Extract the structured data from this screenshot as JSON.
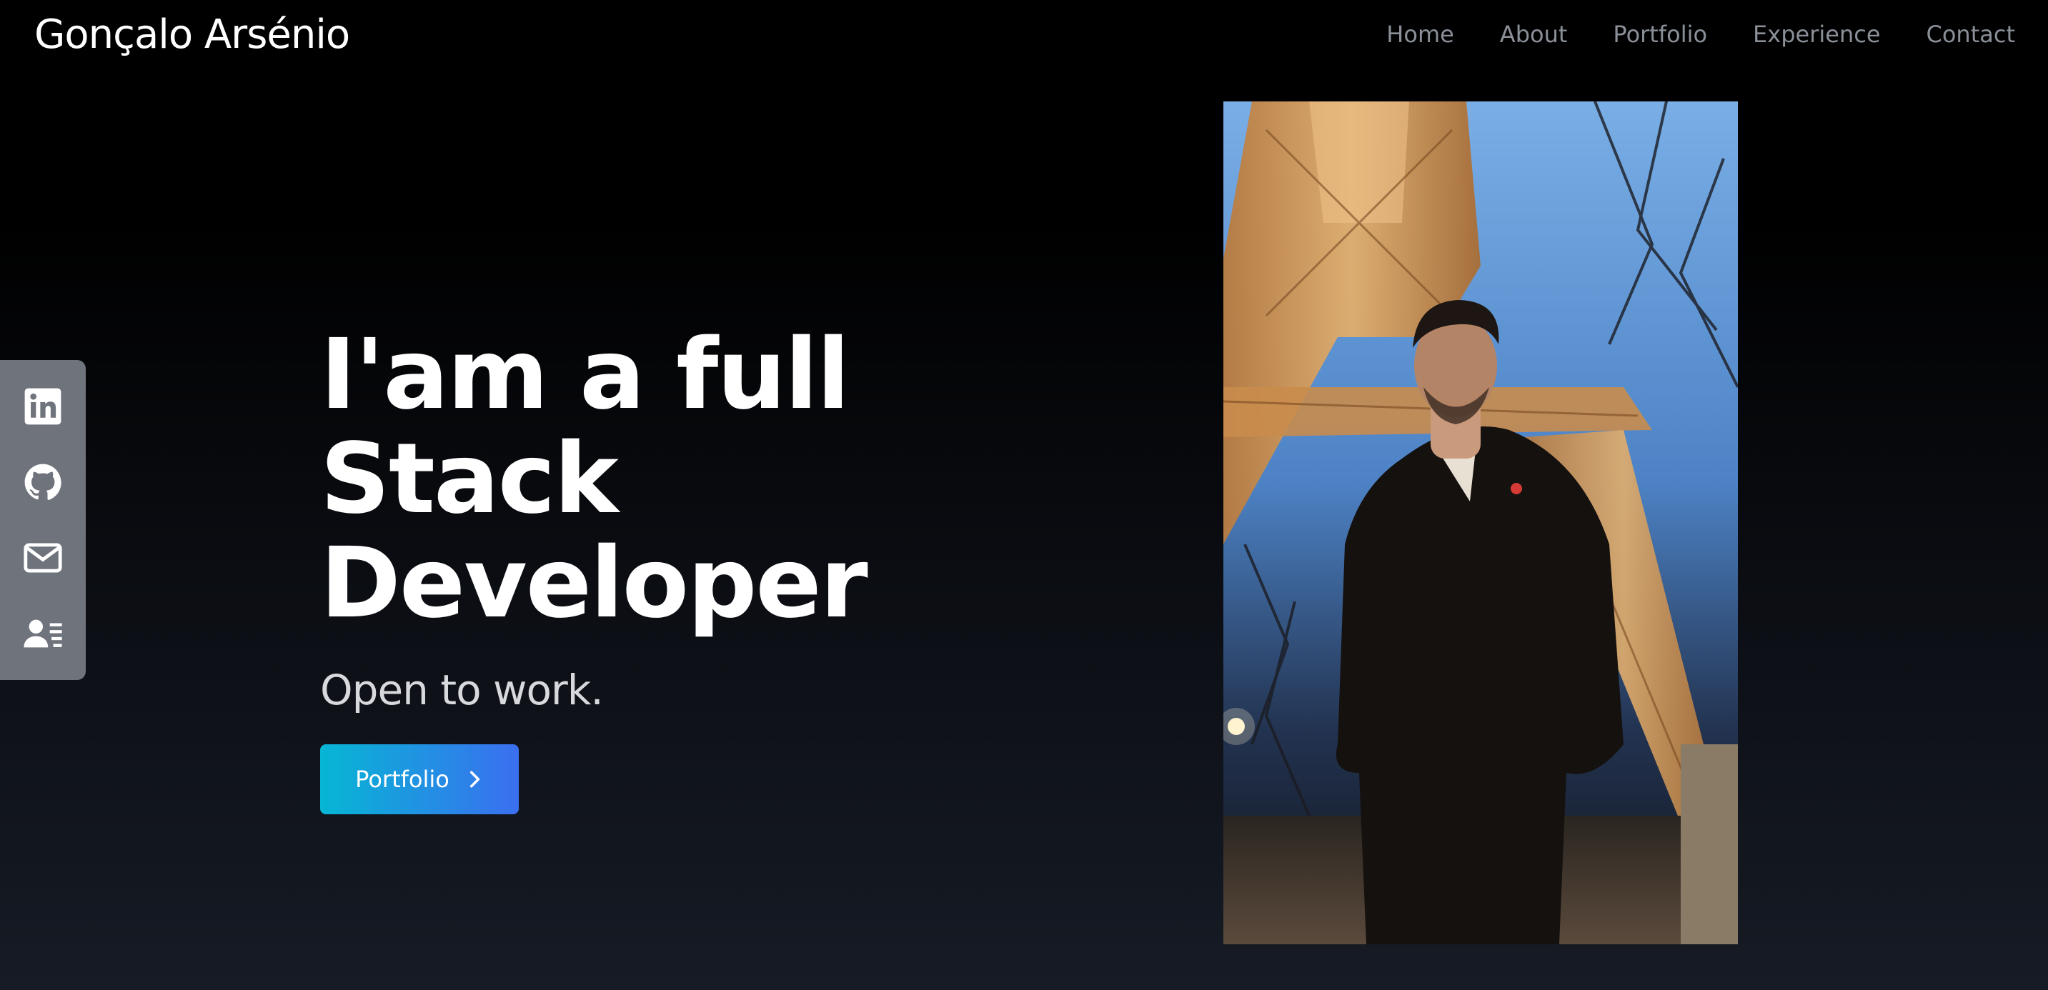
{
  "brand": "Gonçalo Arsénio",
  "nav": [
    "Home",
    "About",
    "Portfolio",
    "Experience",
    "Contact"
  ],
  "social": [
    {
      "icon": "linkedin-icon"
    },
    {
      "icon": "github-icon"
    },
    {
      "icon": "mail-icon"
    },
    {
      "icon": "contact-card-icon"
    }
  ],
  "hero": {
    "headline_line1": "I'am a full Stack",
    "headline_line2": "Developer",
    "subline": "Open to work.",
    "cta_label": "Portfolio"
  },
  "colors": {
    "background_top": "#000000",
    "background_bottom": "#161b25",
    "nav_text": "#8a8f98",
    "sidebar": "#6f747c",
    "cta_start": "#06b6d4",
    "cta_end": "#3b6ff0"
  }
}
